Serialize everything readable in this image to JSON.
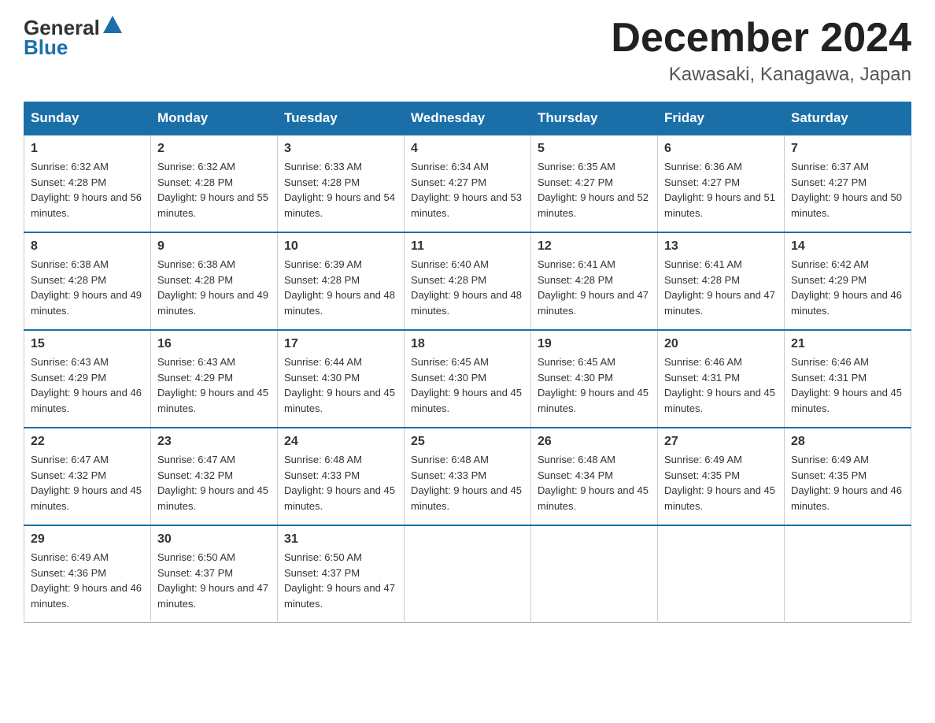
{
  "header": {
    "logo_general": "General",
    "logo_blue": "Blue",
    "title": "December 2024",
    "subtitle": "Kawasaki, Kanagawa, Japan"
  },
  "weekdays": [
    "Sunday",
    "Monday",
    "Tuesday",
    "Wednesday",
    "Thursday",
    "Friday",
    "Saturday"
  ],
  "weeks": [
    [
      {
        "day": "1",
        "sunrise": "Sunrise: 6:32 AM",
        "sunset": "Sunset: 4:28 PM",
        "daylight": "Daylight: 9 hours and 56 minutes."
      },
      {
        "day": "2",
        "sunrise": "Sunrise: 6:32 AM",
        "sunset": "Sunset: 4:28 PM",
        "daylight": "Daylight: 9 hours and 55 minutes."
      },
      {
        "day": "3",
        "sunrise": "Sunrise: 6:33 AM",
        "sunset": "Sunset: 4:28 PM",
        "daylight": "Daylight: 9 hours and 54 minutes."
      },
      {
        "day": "4",
        "sunrise": "Sunrise: 6:34 AM",
        "sunset": "Sunset: 4:27 PM",
        "daylight": "Daylight: 9 hours and 53 minutes."
      },
      {
        "day": "5",
        "sunrise": "Sunrise: 6:35 AM",
        "sunset": "Sunset: 4:27 PM",
        "daylight": "Daylight: 9 hours and 52 minutes."
      },
      {
        "day": "6",
        "sunrise": "Sunrise: 6:36 AM",
        "sunset": "Sunset: 4:27 PM",
        "daylight": "Daylight: 9 hours and 51 minutes."
      },
      {
        "day": "7",
        "sunrise": "Sunrise: 6:37 AM",
        "sunset": "Sunset: 4:27 PM",
        "daylight": "Daylight: 9 hours and 50 minutes."
      }
    ],
    [
      {
        "day": "8",
        "sunrise": "Sunrise: 6:38 AM",
        "sunset": "Sunset: 4:28 PM",
        "daylight": "Daylight: 9 hours and 49 minutes."
      },
      {
        "day": "9",
        "sunrise": "Sunrise: 6:38 AM",
        "sunset": "Sunset: 4:28 PM",
        "daylight": "Daylight: 9 hours and 49 minutes."
      },
      {
        "day": "10",
        "sunrise": "Sunrise: 6:39 AM",
        "sunset": "Sunset: 4:28 PM",
        "daylight": "Daylight: 9 hours and 48 minutes."
      },
      {
        "day": "11",
        "sunrise": "Sunrise: 6:40 AM",
        "sunset": "Sunset: 4:28 PM",
        "daylight": "Daylight: 9 hours and 48 minutes."
      },
      {
        "day": "12",
        "sunrise": "Sunrise: 6:41 AM",
        "sunset": "Sunset: 4:28 PM",
        "daylight": "Daylight: 9 hours and 47 minutes."
      },
      {
        "day": "13",
        "sunrise": "Sunrise: 6:41 AM",
        "sunset": "Sunset: 4:28 PM",
        "daylight": "Daylight: 9 hours and 47 minutes."
      },
      {
        "day": "14",
        "sunrise": "Sunrise: 6:42 AM",
        "sunset": "Sunset: 4:29 PM",
        "daylight": "Daylight: 9 hours and 46 minutes."
      }
    ],
    [
      {
        "day": "15",
        "sunrise": "Sunrise: 6:43 AM",
        "sunset": "Sunset: 4:29 PM",
        "daylight": "Daylight: 9 hours and 46 minutes."
      },
      {
        "day": "16",
        "sunrise": "Sunrise: 6:43 AM",
        "sunset": "Sunset: 4:29 PM",
        "daylight": "Daylight: 9 hours and 45 minutes."
      },
      {
        "day": "17",
        "sunrise": "Sunrise: 6:44 AM",
        "sunset": "Sunset: 4:30 PM",
        "daylight": "Daylight: 9 hours and 45 minutes."
      },
      {
        "day": "18",
        "sunrise": "Sunrise: 6:45 AM",
        "sunset": "Sunset: 4:30 PM",
        "daylight": "Daylight: 9 hours and 45 minutes."
      },
      {
        "day": "19",
        "sunrise": "Sunrise: 6:45 AM",
        "sunset": "Sunset: 4:30 PM",
        "daylight": "Daylight: 9 hours and 45 minutes."
      },
      {
        "day": "20",
        "sunrise": "Sunrise: 6:46 AM",
        "sunset": "Sunset: 4:31 PM",
        "daylight": "Daylight: 9 hours and 45 minutes."
      },
      {
        "day": "21",
        "sunrise": "Sunrise: 6:46 AM",
        "sunset": "Sunset: 4:31 PM",
        "daylight": "Daylight: 9 hours and 45 minutes."
      }
    ],
    [
      {
        "day": "22",
        "sunrise": "Sunrise: 6:47 AM",
        "sunset": "Sunset: 4:32 PM",
        "daylight": "Daylight: 9 hours and 45 minutes."
      },
      {
        "day": "23",
        "sunrise": "Sunrise: 6:47 AM",
        "sunset": "Sunset: 4:32 PM",
        "daylight": "Daylight: 9 hours and 45 minutes."
      },
      {
        "day": "24",
        "sunrise": "Sunrise: 6:48 AM",
        "sunset": "Sunset: 4:33 PM",
        "daylight": "Daylight: 9 hours and 45 minutes."
      },
      {
        "day": "25",
        "sunrise": "Sunrise: 6:48 AM",
        "sunset": "Sunset: 4:33 PM",
        "daylight": "Daylight: 9 hours and 45 minutes."
      },
      {
        "day": "26",
        "sunrise": "Sunrise: 6:48 AM",
        "sunset": "Sunset: 4:34 PM",
        "daylight": "Daylight: 9 hours and 45 minutes."
      },
      {
        "day": "27",
        "sunrise": "Sunrise: 6:49 AM",
        "sunset": "Sunset: 4:35 PM",
        "daylight": "Daylight: 9 hours and 45 minutes."
      },
      {
        "day": "28",
        "sunrise": "Sunrise: 6:49 AM",
        "sunset": "Sunset: 4:35 PM",
        "daylight": "Daylight: 9 hours and 46 minutes."
      }
    ],
    [
      {
        "day": "29",
        "sunrise": "Sunrise: 6:49 AM",
        "sunset": "Sunset: 4:36 PM",
        "daylight": "Daylight: 9 hours and 46 minutes."
      },
      {
        "day": "30",
        "sunrise": "Sunrise: 6:50 AM",
        "sunset": "Sunset: 4:37 PM",
        "daylight": "Daylight: 9 hours and 47 minutes."
      },
      {
        "day": "31",
        "sunrise": "Sunrise: 6:50 AM",
        "sunset": "Sunset: 4:37 PM",
        "daylight": "Daylight: 9 hours and 47 minutes."
      },
      null,
      null,
      null,
      null
    ]
  ]
}
